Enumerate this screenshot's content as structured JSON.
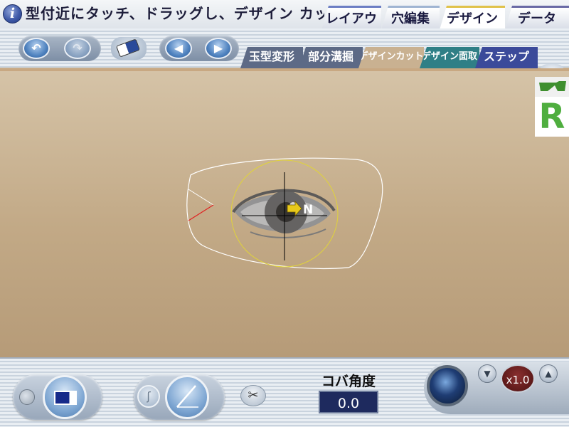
{
  "header": {
    "info_icon": "i",
    "hint": "型付近にタッチ、ドラッグし、デザイン カットを",
    "tabs": [
      {
        "id": "layout",
        "label": "レイアウト"
      },
      {
        "id": "hole",
        "label": "穴編集"
      },
      {
        "id": "design",
        "label": "デザイン",
        "active": true
      },
      {
        "id": "data",
        "label": "データ"
      }
    ]
  },
  "toolbar": {
    "icons": [
      "undo-icon",
      "redo-icon",
      "eraser-icon",
      "prev-icon",
      "next-icon",
      "camera-icon"
    ],
    "undo_glyph": "↶",
    "redo_glyph": "↷",
    "prev_glyph": "◀",
    "next_glyph": "▶",
    "subtabs": [
      {
        "id": "shape",
        "label": "玉型変形"
      },
      {
        "id": "partial",
        "label": "部分溝掘"
      },
      {
        "id": "cut",
        "label": "デザインカット",
        "active": true
      },
      {
        "id": "face",
        "label": "デザイン面取"
      },
      {
        "id": "step",
        "label": "ステップ"
      }
    ]
  },
  "canvas": {
    "direction_label": "N",
    "side_label": "R",
    "colors": {
      "lens_outline": "#ffffff",
      "layout_circle": "#e0d33a",
      "crosshair": "#000000",
      "cut_line": "#e02020",
      "arrow": "#e8c91a"
    }
  },
  "bottom": {
    "edge_angle_label": "コバ角度",
    "edge_angle_value": "0.0",
    "zoom_value": "x1.0",
    "zoom_down_glyph": "▼",
    "zoom_up_glyph": "▲",
    "scissors_glyph": "✂",
    "curve_glyph": "ʃ"
  }
}
